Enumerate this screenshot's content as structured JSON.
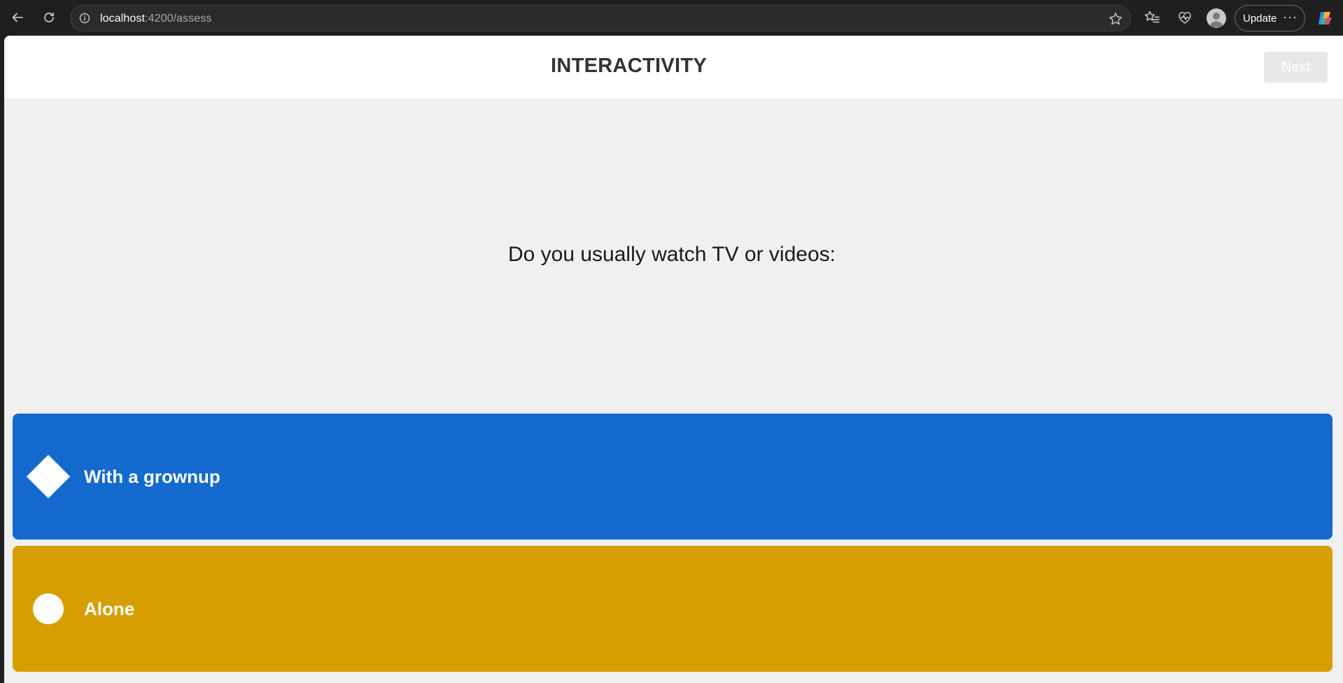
{
  "browser": {
    "url_host": "localhost",
    "url_rest": ":4200/assess",
    "update_label": "Update",
    "more_label": "···"
  },
  "header": {
    "title": "INTERACTIVITY",
    "next_label": "Next"
  },
  "question": {
    "text": "Do you usually watch TV or videos:"
  },
  "answers": [
    {
      "label": "With a grownup",
      "color": "#1469cf",
      "shape": "diamond-icon"
    },
    {
      "label": "Alone",
      "color": "#d69e00",
      "shape": "circle-icon"
    }
  ]
}
